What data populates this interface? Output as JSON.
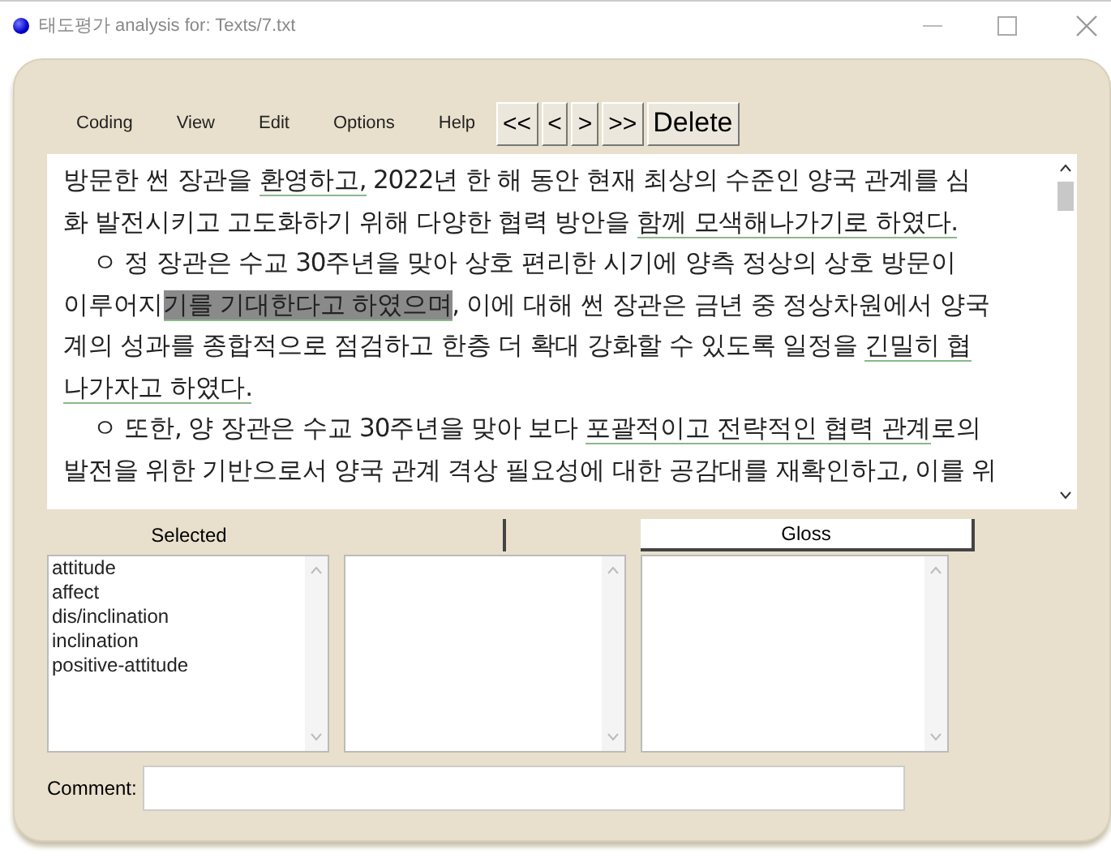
{
  "window": {
    "title": "태도평가 analysis for: Texts/7.txt"
  },
  "menu": [
    "Coding",
    "View",
    "Edit",
    "Options",
    "Help"
  ],
  "nav_buttons": [
    "<<",
    "<",
    ">",
    ">>",
    "Delete"
  ],
  "text_lines": [
    {
      "indent": false,
      "segments": [
        {
          "kind": "plain",
          "text": "방문한 썬 장관을 "
        },
        {
          "kind": "coded",
          "text": "환영하고,"
        },
        {
          "kind": "plain",
          "text": " 2022년 한 해 동안 현재 최상의 수준인 양국 관계를 심"
        }
      ]
    },
    {
      "indent": false,
      "segments": [
        {
          "kind": "plain",
          "text": "화 발전시키고 고도화하기 위해 다양한 협력 방안을 "
        },
        {
          "kind": "coded",
          "text": "함께 모색해나가기로 하였다."
        }
      ]
    },
    {
      "indent": true,
      "segments": [
        {
          "kind": "plain",
          "text": "ㅇ 정 장관은 수교 30주년을 맞아 상호 편리한 시기에 양측 정상의 상호 방문이"
        }
      ]
    },
    {
      "indent": false,
      "segments": [
        {
          "kind": "plain",
          "text": "이루어지"
        },
        {
          "kind": "selected",
          "text": "기를 기대한다고 하였으며"
        },
        {
          "kind": "plain",
          "text": ", 이에 대해 썬 장관은 금년 중 정상차원에서 양국"
        }
      ]
    },
    {
      "indent": false,
      "segments": [
        {
          "kind": "plain",
          "text": "계의 성과를 종합적으로 점검하고 한층 더 확대 강화할 수 있도록 일정을 "
        },
        {
          "kind": "coded",
          "text": "긴밀히 협"
        }
      ]
    },
    {
      "indent": false,
      "segments": [
        {
          "kind": "coded",
          "text": "나가자고 하였다."
        }
      ]
    },
    {
      "indent": true,
      "segments": [
        {
          "kind": "plain",
          "text": "ㅇ 또한, 양 장관은 수교 30주년을 맞아 보다 "
        },
        {
          "kind": "coded",
          "text": "포괄적이고 전략적인 협력 관계"
        },
        {
          "kind": "plain",
          "text": "로의"
        }
      ]
    },
    {
      "indent": false,
      "segments": [
        {
          "kind": "plain",
          "text": "발전을 위한 기반으로서 양국 관계 격상 필요성에 대한 공감대를 재확인하고, 이를 위"
        }
      ]
    }
  ],
  "panels": [
    {
      "header": {
        "kind": "label",
        "text": "Selected"
      },
      "items": [
        "attitude",
        "affect",
        "dis/inclination",
        "inclination",
        "positive-attitude"
      ]
    },
    {
      "header": {
        "kind": "button"
      }
    },
    {
      "header": {
        "kind": "button",
        "text": "Gloss"
      }
    }
  ],
  "comment": {
    "label": "Comment:"
  }
}
